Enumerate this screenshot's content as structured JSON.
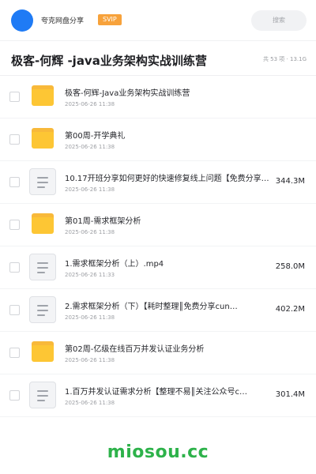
{
  "header": {
    "brand": "夸克网盘分享",
    "badge": "SVIP",
    "search_label": "搜索"
  },
  "folder": {
    "title": "极客-何辉 -java业务架构实战训练营",
    "meta": "共 53 项 · 13.1G"
  },
  "items": [
    {
      "type": "folder",
      "name": "极客-何辉-Java业务架构实战训练营",
      "date": "2025-06-26 11:38",
      "size": ""
    },
    {
      "type": "folder",
      "name": "第00周-开学典礼",
      "date": "2025-06-26 11:38",
      "size": ""
    },
    {
      "type": "file",
      "name": "10.17开班分享如何更好的快速修复线上问题【免费分享cun…",
      "date": "2025-06-26 11:38",
      "size": "344.3M"
    },
    {
      "type": "folder",
      "name": "第01周-需求框架分析",
      "date": "2025-06-26 11:38",
      "size": ""
    },
    {
      "type": "file",
      "name": "1.需求框架分析（上）.mp4",
      "date": "2025-06-26 11:33",
      "size": "258.0M"
    },
    {
      "type": "file",
      "name": "2.需求框架分析（下）【耗时整理║免费分享cun…",
      "date": "2025-06-26 11:38",
      "size": "402.2M",
      "wrap": true
    },
    {
      "type": "folder",
      "name": "第02周-亿级在线百万并发认证业务分析",
      "date": "2025-06-26 11:38",
      "size": ""
    },
    {
      "type": "file",
      "name": "1.百万并发认证需求分析【整理不易║关注公众号c…",
      "date": "2025-06-26 11:38",
      "size": "301.4M",
      "wrap": true
    }
  ],
  "watermark": "miosou.cc"
}
